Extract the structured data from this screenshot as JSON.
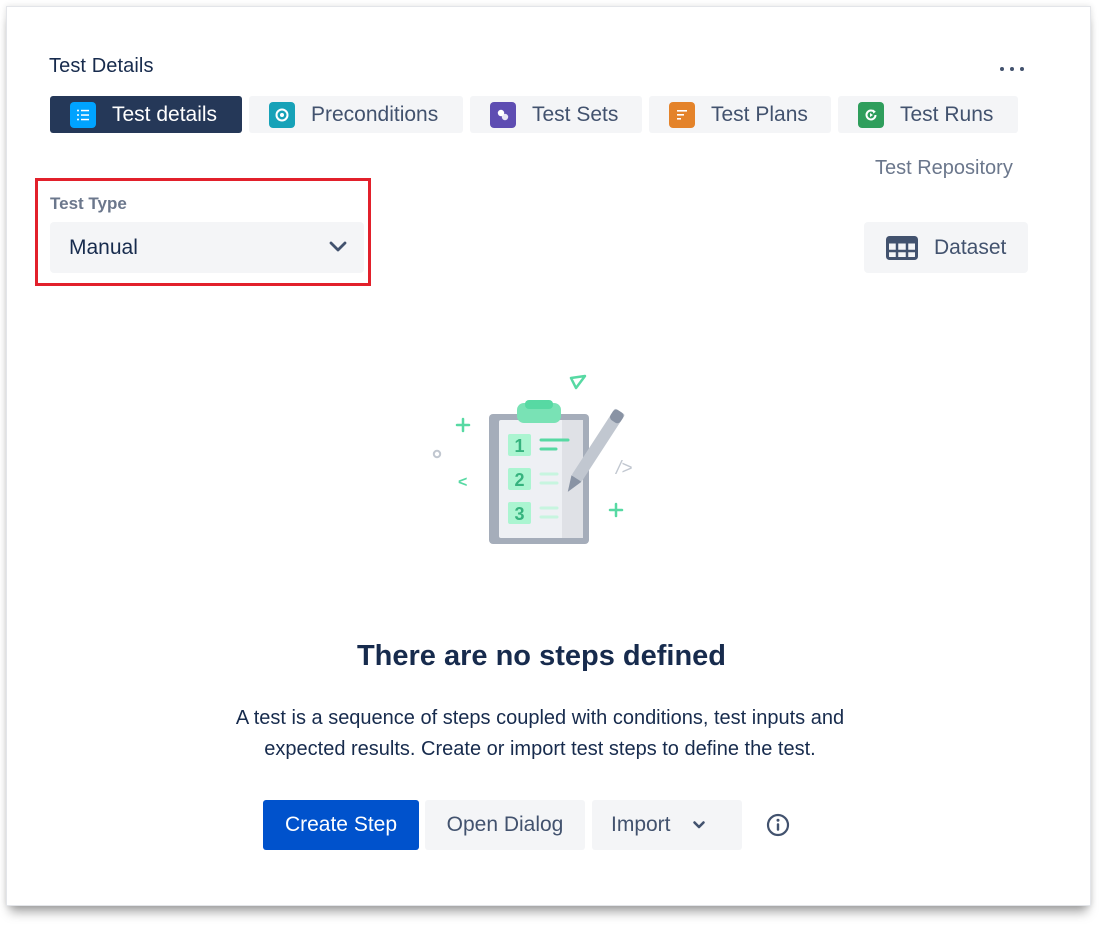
{
  "panel": {
    "title": "Test Details",
    "more_icon": "more-horizontal-icon"
  },
  "tabs": [
    {
      "label": "Test details",
      "icon": "list-icon",
      "color": "#00a3ff",
      "active": true
    },
    {
      "label": "Preconditions",
      "icon": "precondition-icon",
      "color": "#17a2b8",
      "active": false
    },
    {
      "label": "Test Sets",
      "icon": "test-set-icon",
      "color": "#5e4db2",
      "active": false
    },
    {
      "label": "Test Plans",
      "icon": "test-plan-icon",
      "color": "#e4832a",
      "active": false
    },
    {
      "label": "Test Runs",
      "icon": "test-run-icon",
      "color": "#36b37e",
      "active": false
    }
  ],
  "repository": {
    "label": "Test Repository"
  },
  "test_type": {
    "label": "Test Type",
    "value": "Manual"
  },
  "dataset": {
    "label": "Dataset",
    "icon": "table-icon"
  },
  "empty_state": {
    "step_numbers": [
      "1",
      "2",
      "3"
    ],
    "code_glyph": "/>",
    "lt_glyph": "<",
    "title": "There are no steps defined",
    "description_line1": "A test is a sequence of steps coupled with conditions, test inputs and",
    "description_line2": "expected results. Create or import test steps to define the test."
  },
  "actions": {
    "create_step": "Create Step",
    "open_dialog": "Open Dialog",
    "import": "Import"
  },
  "colors": {
    "accent": "#0052cc",
    "active_tab": "#253858",
    "highlight": "#e2202b",
    "illustration_green": "#57d9a3"
  }
}
